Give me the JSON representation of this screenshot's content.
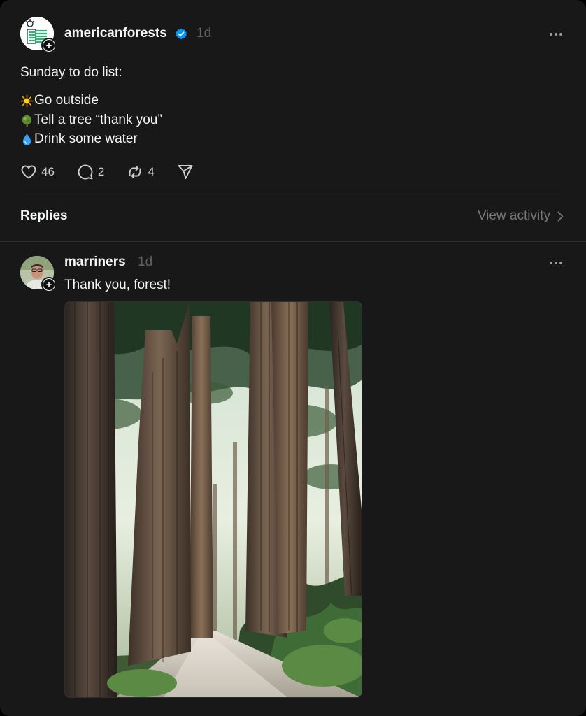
{
  "post": {
    "username": "americanforests",
    "verified": true,
    "timestamp": "1d",
    "text": "Sunday to do list:",
    "list_items": [
      {
        "icon": "sun-emoji",
        "text": "Go outside"
      },
      {
        "icon": "tree-emoji",
        "text": "Tell a tree “thank you”"
      },
      {
        "icon": "droplet-emoji",
        "text": "Drink some water"
      }
    ],
    "likes": "46",
    "replies": "2",
    "reposts": "4"
  },
  "replies_section": {
    "label": "Replies",
    "view_activity": "View activity"
  },
  "reply": {
    "username": "marriners",
    "timestamp": "1d",
    "text": "Thank you, forest!"
  },
  "colors": {
    "background": "#181818",
    "text": "#f3f5f7",
    "muted": "#616161",
    "verified": "#0095f6",
    "divider": "#2d2d2d"
  }
}
